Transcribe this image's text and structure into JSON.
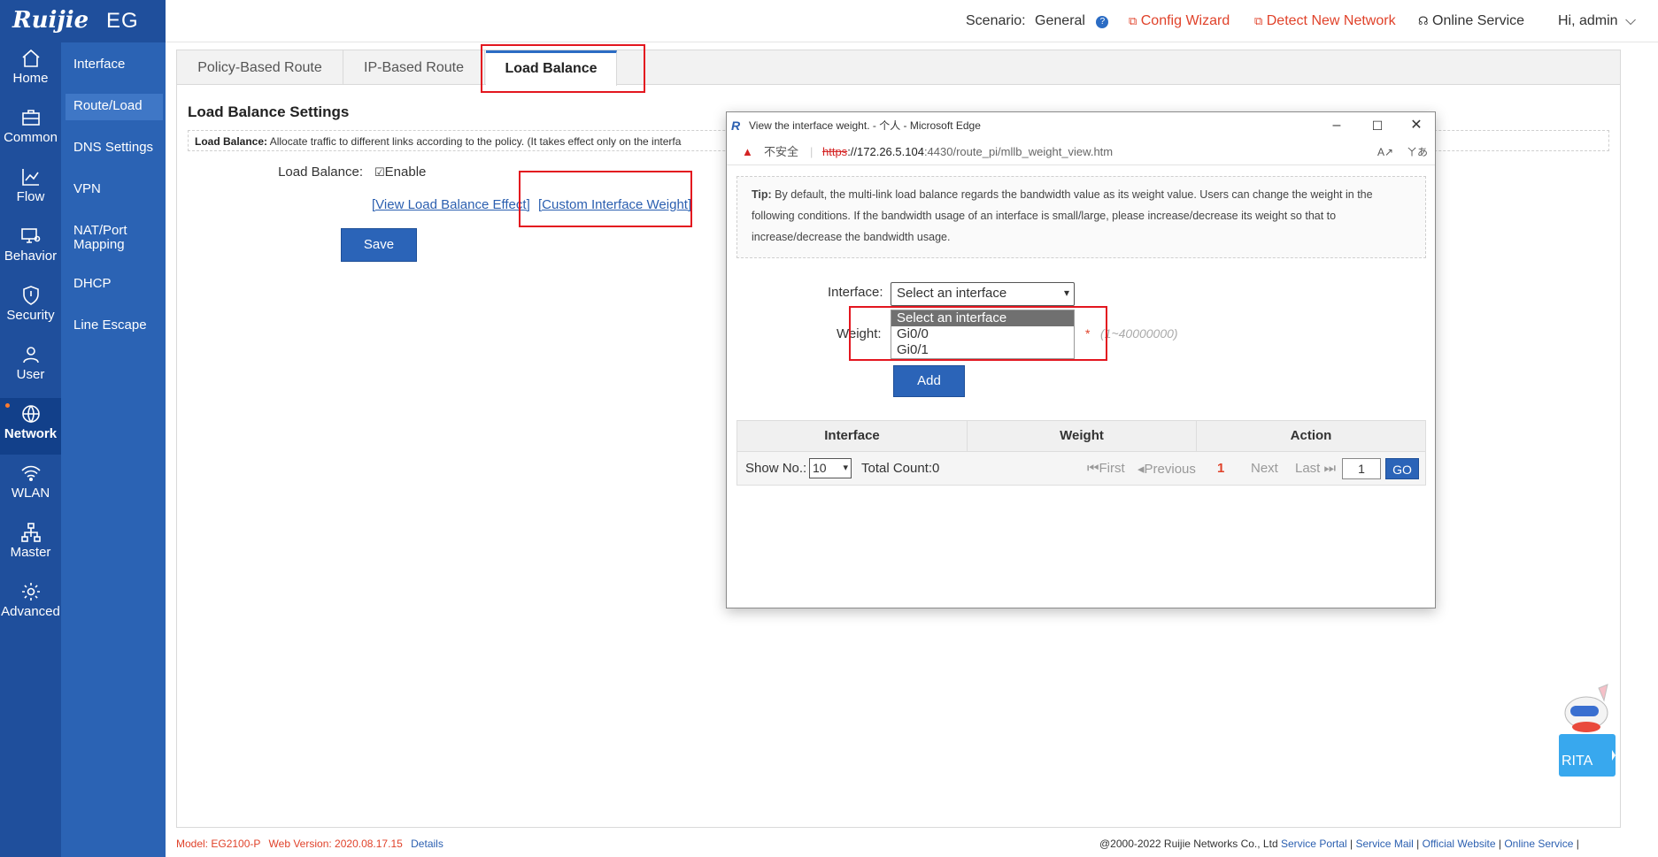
{
  "brand": {
    "name": "Ruijie",
    "model": "EG"
  },
  "rail": [
    {
      "label": "Home",
      "icon": "home-icon"
    },
    {
      "label": "Common",
      "icon": "briefcase-icon"
    },
    {
      "label": "Flow",
      "icon": "chart-icon"
    },
    {
      "label": "Behavior",
      "icon": "monitor-user-icon"
    },
    {
      "label": "Security",
      "icon": "shield-icon"
    },
    {
      "label": "User",
      "icon": "user-icon"
    },
    {
      "label": "Network",
      "icon": "globe-icon",
      "active": true
    },
    {
      "label": "WLAN",
      "icon": "wifi-icon"
    },
    {
      "label": "Master",
      "icon": "network-tree-icon"
    },
    {
      "label": "Advanced",
      "icon": "gear-icon"
    }
  ],
  "subnav": [
    "Interface",
    "Route/Load",
    "DNS Settings",
    "VPN",
    "NAT/Port Mapping",
    "DHCP",
    "Line Escape"
  ],
  "topbar": {
    "scenario_label": "Scenario:",
    "scenario_value": "General",
    "config_wizard": "Config Wizard",
    "detect_network": "Detect New Network",
    "online_service": "Online Service",
    "greeting": "Hi, admin"
  },
  "tabs": [
    "Policy-Based Route",
    "IP-Based Route",
    "Load Balance"
  ],
  "settings": {
    "title": "Load Balance Settings",
    "desc_label": "Load Balance:",
    "desc_text": "Allocate traffic to different links according to the policy. (It takes effect only on the interfa",
    "lb_label": "Load Balance:",
    "enable_label": "Enable",
    "view_effect_link": "[View Load Balance Effect]",
    "custom_weight_link": "[Custom Interface Weight]",
    "save_label": "Save"
  },
  "modal": {
    "window_title": "View the interface weight. - 个人 - Microsoft Edge",
    "insecure_label": "不安全",
    "url_scheme": "https",
    "url_host": "://172.26.5.104",
    "url_rest": ":4430/route_pi/mllb_weight_view.htm",
    "tip_label": "Tip:",
    "tip_text": "By default, the multi-link load balance regards the bandwidth value as its weight value. Users can change the weight in the following conditions. If the bandwidth usage of an interface is small/large, please increase/decrease its weight so that to increase/decrease the bandwidth usage.",
    "interface_label": "Interface:",
    "interface_selected": "Select an interface",
    "interface_options": [
      "Select an interface",
      "Gi0/0",
      "Gi0/1"
    ],
    "weight_label": "Weight:",
    "weight_star": "*",
    "weight_hint": "(1~40000000)",
    "add_label": "Add",
    "table_headers": [
      "Interface",
      "Weight",
      "Action"
    ],
    "pager": {
      "show_no_label": "Show No.:",
      "show_no_value": "10",
      "total_count": "Total Count:0",
      "first": "First",
      "previous": "Previous",
      "current_page": "1",
      "next": "Next",
      "last": "Last",
      "page_input": "1",
      "go": "GO"
    }
  },
  "footer": {
    "model_label": "Model:",
    "model_value": "EG2100-P",
    "web_version_label": "Web Version:",
    "web_version_value": "2020.08.17.15",
    "details": "Details",
    "copyright": "@2000-2022 Ruijie Networks Co., Ltd",
    "links": [
      "Service Portal",
      "Service Mail",
      "Official Website",
      "Online Service"
    ]
  },
  "assistant": {
    "label": "RITA"
  },
  "colors": {
    "nav_dark": "#1f4f9c",
    "nav_sub": "#2b63b4",
    "accent_red": "#e0422a",
    "button_blue": "#2b64b8",
    "highlight_red": "#e3161f"
  }
}
